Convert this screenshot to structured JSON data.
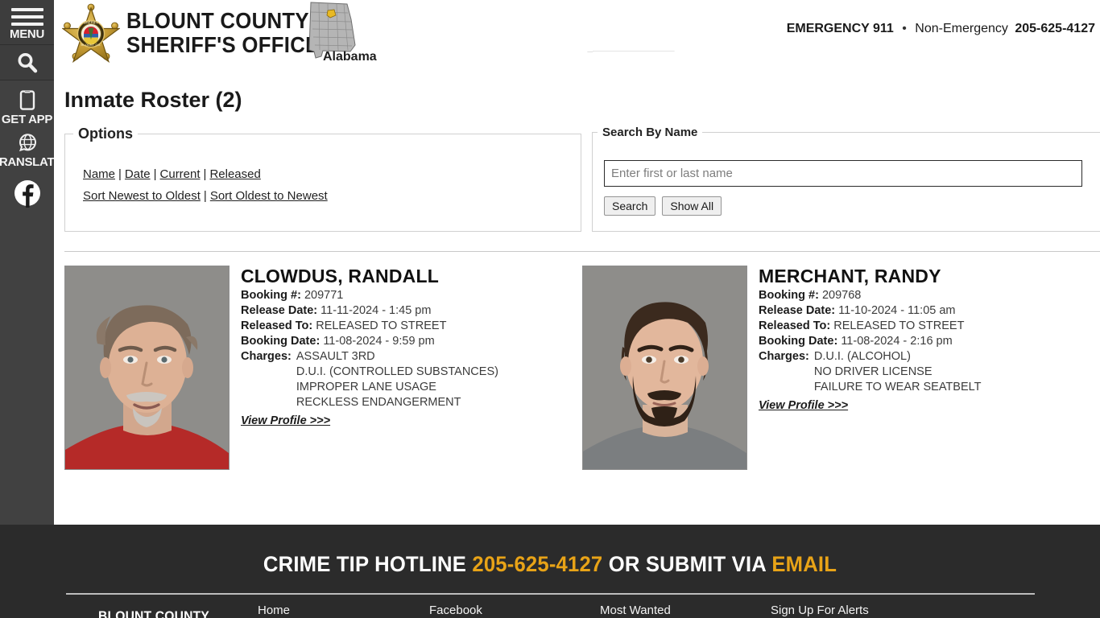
{
  "sidebar": {
    "menu_label": "MENU",
    "search_icon": "search-icon",
    "items": [
      {
        "icon": "mobile-phone-icon",
        "label": "GET APP"
      },
      {
        "icon": "globe-translate-icon",
        "label": "TRANSLATE"
      },
      {
        "icon": "facebook-icon",
        "label": ""
      }
    ]
  },
  "header": {
    "badge_icon": "sheriff-star-badge-icon",
    "title_line1": "BLOUNT COUNTY",
    "title_line2": "SHERIFF'S OFFICE",
    "state_map_icon": "alabama-state-map-icon",
    "state_label": "Alabama",
    "emergency_label": "EMERGENCY 911",
    "separator": "•",
    "non_emergency_label": "Non-Emergency",
    "non_emergency_phone": "205-625-4127"
  },
  "main": {
    "page_title": "Inmate Roster (2)",
    "options": {
      "legend": "Options",
      "filters": [
        {
          "label": "Name"
        },
        {
          "label": "Date"
        },
        {
          "label": "Current"
        },
        {
          "label": "Released"
        }
      ],
      "sorts": [
        {
          "label": "Sort Newest to Oldest"
        },
        {
          "label": "Sort Oldest to Newest"
        }
      ],
      "separator": "|"
    },
    "search": {
      "legend": "Search By Name",
      "placeholder": "Enter first or last name",
      "value": "",
      "search_button": "Search",
      "show_all_button": "Show All"
    },
    "labels": {
      "booking_number": "Booking #:",
      "release_date": "Release Date:",
      "released_to": "Released To:",
      "booking_date": "Booking Date:",
      "charges": "Charges:",
      "view_profile": "View Profile >>>"
    },
    "inmates": [
      {
        "name": "CLOWDUS, RANDALL",
        "booking_number": "209771",
        "release_date": "11-11-2024 - 1:45 pm",
        "released_to": "RELEASED TO STREET",
        "booking_date": "11-08-2024 - 9:59 pm",
        "charges": [
          "ASSAULT 3RD",
          "D.U.I. (CONTROLLED SUBSTANCES)",
          "IMPROPER LANE USAGE",
          "RECKLESS ENDANGERMENT"
        ],
        "mugshot": "mugshot-photo"
      },
      {
        "name": "MERCHANT, RANDY",
        "booking_number": "209768",
        "release_date": "11-10-2024 - 11:05 am",
        "released_to": "RELEASED TO STREET",
        "booking_date": "11-08-2024 - 2:16 pm",
        "charges": [
          "D.U.I. (ALCOHOL)",
          "NO DRIVER LICENSE",
          "FAILURE TO WEAR SEATBELT"
        ],
        "mugshot": "mugshot-photo"
      }
    ]
  },
  "footer": {
    "hotline_prefix": "CRIME TIP HOTLINE",
    "hotline_phone": "205-625-4127",
    "hotline_middle": "OR SUBMIT VIA",
    "hotline_email": "EMAIL",
    "logo_text": "BLOUNT COUNTY",
    "links": [
      {
        "label": "Home"
      },
      {
        "label": "Facebook"
      },
      {
        "label": "Most Wanted"
      },
      {
        "label": "Sign Up For Alerts"
      }
    ]
  },
  "colors": {
    "sidebar_bg": "#414141",
    "footer_bg": "#2b2b2b",
    "accent_gold": "#e8a317",
    "text_dark": "#1a1a1a"
  }
}
